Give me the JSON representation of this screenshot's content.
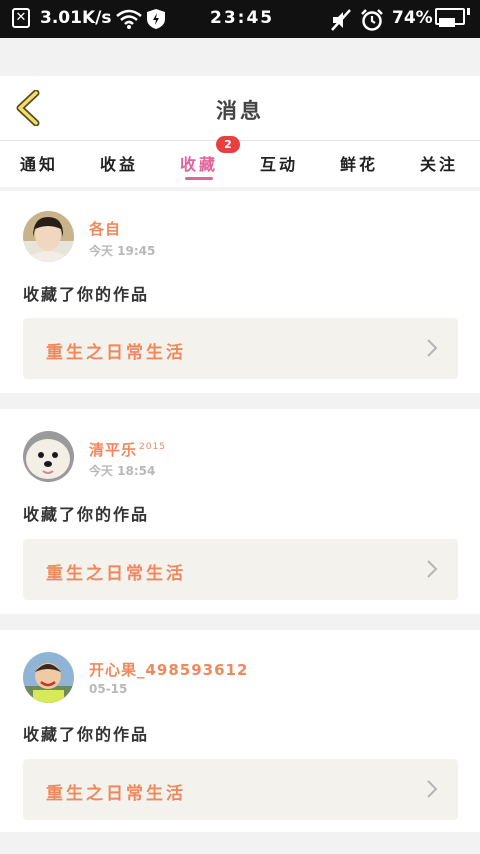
{
  "status_bar": {
    "sim_icon": "sim-off-icon",
    "sim_glyph": "✕",
    "net_speed": "3.01K/s",
    "time": "23:45",
    "battery_percent": "74%",
    "battery_level": 0.74
  },
  "header": {
    "title": "消息"
  },
  "tabs": [
    {
      "label": "通知"
    },
    {
      "label": "收益"
    },
    {
      "label": "收藏",
      "badge": "2"
    },
    {
      "label": "互动"
    },
    {
      "label": "鲜花"
    },
    {
      "label": "关注"
    }
  ],
  "active_tab": "收藏",
  "messages": [
    {
      "user": "各自",
      "user_sup": "",
      "time": "今天 19:45",
      "action": "收藏了你的作品",
      "work_title": "重生之日常生活"
    },
    {
      "user": "清平乐",
      "user_sup": "2015",
      "time": "今天 18:54",
      "action": "收藏了你的作品",
      "work_title": "重生之日常生活"
    },
    {
      "user": "开心果_498593612",
      "user_sup": "",
      "time": "05-15",
      "action": "收藏了你的作品",
      "work_title": "重生之日常生活"
    }
  ],
  "colors": {
    "accent_pink": "#e0649a",
    "username_orange": "#f0885e",
    "badge_red": "#e8403f"
  }
}
